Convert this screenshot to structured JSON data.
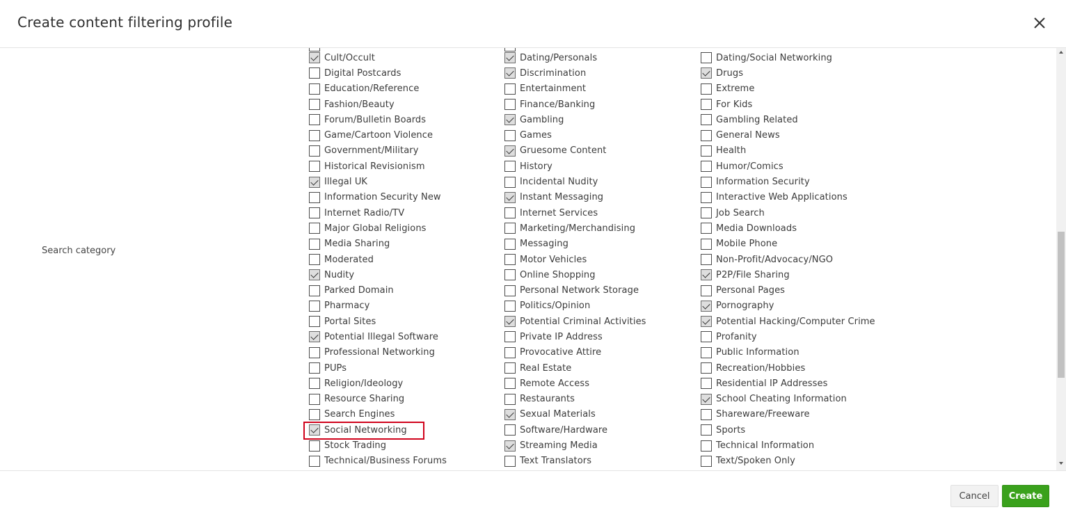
{
  "dialog": {
    "title": "Create content filtering profile",
    "close_icon": "close-icon"
  },
  "form": {
    "search_category_label": "Search category"
  },
  "categories": {
    "col1": [
      {
        "label": "Cult/Occult",
        "checked": true
      },
      {
        "label": "Digital Postcards",
        "checked": false
      },
      {
        "label": "Education/Reference",
        "checked": false
      },
      {
        "label": "Fashion/Beauty",
        "checked": false
      },
      {
        "label": "Forum/Bulletin Boards",
        "checked": false
      },
      {
        "label": "Game/Cartoon Violence",
        "checked": false
      },
      {
        "label": "Government/Military",
        "checked": false
      },
      {
        "label": "Historical Revisionism",
        "checked": false
      },
      {
        "label": "Illegal UK",
        "checked": true
      },
      {
        "label": "Information Security New",
        "checked": false
      },
      {
        "label": "Internet Radio/TV",
        "checked": false
      },
      {
        "label": "Major Global Religions",
        "checked": false
      },
      {
        "label": "Media Sharing",
        "checked": false
      },
      {
        "label": "Moderated",
        "checked": false
      },
      {
        "label": "Nudity",
        "checked": true
      },
      {
        "label": "Parked Domain",
        "checked": false
      },
      {
        "label": "Pharmacy",
        "checked": false
      },
      {
        "label": "Portal Sites",
        "checked": false
      },
      {
        "label": "Potential Illegal Software",
        "checked": true
      },
      {
        "label": "Professional Networking",
        "checked": false
      },
      {
        "label": "PUPs",
        "checked": false
      },
      {
        "label": "Religion/Ideology",
        "checked": false
      },
      {
        "label": "Resource Sharing",
        "checked": false
      },
      {
        "label": "Search Engines",
        "checked": false
      },
      {
        "label": "Social Networking",
        "checked": true
      },
      {
        "label": "Stock Trading",
        "checked": false
      },
      {
        "label": "Technical/Business Forums",
        "checked": false
      }
    ],
    "col2": [
      {
        "label": "Dating/Personals",
        "checked": true
      },
      {
        "label": "Discrimination",
        "checked": true
      },
      {
        "label": "Entertainment",
        "checked": false
      },
      {
        "label": "Finance/Banking",
        "checked": false
      },
      {
        "label": "Gambling",
        "checked": true
      },
      {
        "label": "Games",
        "checked": false
      },
      {
        "label": "Gruesome Content",
        "checked": true
      },
      {
        "label": "History",
        "checked": false
      },
      {
        "label": "Incidental Nudity",
        "checked": false
      },
      {
        "label": "Instant Messaging",
        "checked": true
      },
      {
        "label": "Internet Services",
        "checked": false
      },
      {
        "label": "Marketing/Merchandising",
        "checked": false
      },
      {
        "label": "Messaging",
        "checked": false
      },
      {
        "label": "Motor Vehicles",
        "checked": false
      },
      {
        "label": "Online Shopping",
        "checked": false
      },
      {
        "label": "Personal Network Storage",
        "checked": false
      },
      {
        "label": "Politics/Opinion",
        "checked": false
      },
      {
        "label": "Potential Criminal Activities",
        "checked": true
      },
      {
        "label": "Private IP Address",
        "checked": false
      },
      {
        "label": "Provocative Attire",
        "checked": false
      },
      {
        "label": "Real Estate",
        "checked": false
      },
      {
        "label": "Remote Access",
        "checked": false
      },
      {
        "label": "Restaurants",
        "checked": false
      },
      {
        "label": "Sexual Materials",
        "checked": true
      },
      {
        "label": "Software/Hardware",
        "checked": false
      },
      {
        "label": "Streaming Media",
        "checked": true
      },
      {
        "label": "Text Translators",
        "checked": false
      }
    ],
    "col3": [
      {
        "label": "Dating/Social Networking",
        "checked": false
      },
      {
        "label": "Drugs",
        "checked": true
      },
      {
        "label": "Extreme",
        "checked": false
      },
      {
        "label": "For Kids",
        "checked": false
      },
      {
        "label": "Gambling Related",
        "checked": false
      },
      {
        "label": "General News",
        "checked": false
      },
      {
        "label": "Health",
        "checked": false
      },
      {
        "label": "Humor/Comics",
        "checked": false
      },
      {
        "label": "Information Security",
        "checked": false
      },
      {
        "label": "Interactive Web Applications",
        "checked": false
      },
      {
        "label": "Job Search",
        "checked": false
      },
      {
        "label": "Media Downloads",
        "checked": false
      },
      {
        "label": "Mobile Phone",
        "checked": false
      },
      {
        "label": "Non-Profit/Advocacy/NGO",
        "checked": false
      },
      {
        "label": "P2P/File Sharing",
        "checked": true
      },
      {
        "label": "Personal Pages",
        "checked": false
      },
      {
        "label": "Pornography",
        "checked": true
      },
      {
        "label": "Potential Hacking/Computer Crime",
        "checked": true
      },
      {
        "label": "Profanity",
        "checked": false
      },
      {
        "label": "Public Information",
        "checked": false
      },
      {
        "label": "Recreation/Hobbies",
        "checked": false
      },
      {
        "label": "Residential IP Addresses",
        "checked": false
      },
      {
        "label": "School Cheating Information",
        "checked": true
      },
      {
        "label": "Shareware/Freeware",
        "checked": false
      },
      {
        "label": "Sports",
        "checked": false
      },
      {
        "label": "Technical Information",
        "checked": false
      },
      {
        "label": "Text/Spoken Only",
        "checked": false
      }
    ]
  },
  "footer": {
    "cancel_label": "Cancel",
    "create_label": "Create"
  },
  "colors": {
    "accent": "#3aa11c",
    "highlight": "#d0021b"
  }
}
